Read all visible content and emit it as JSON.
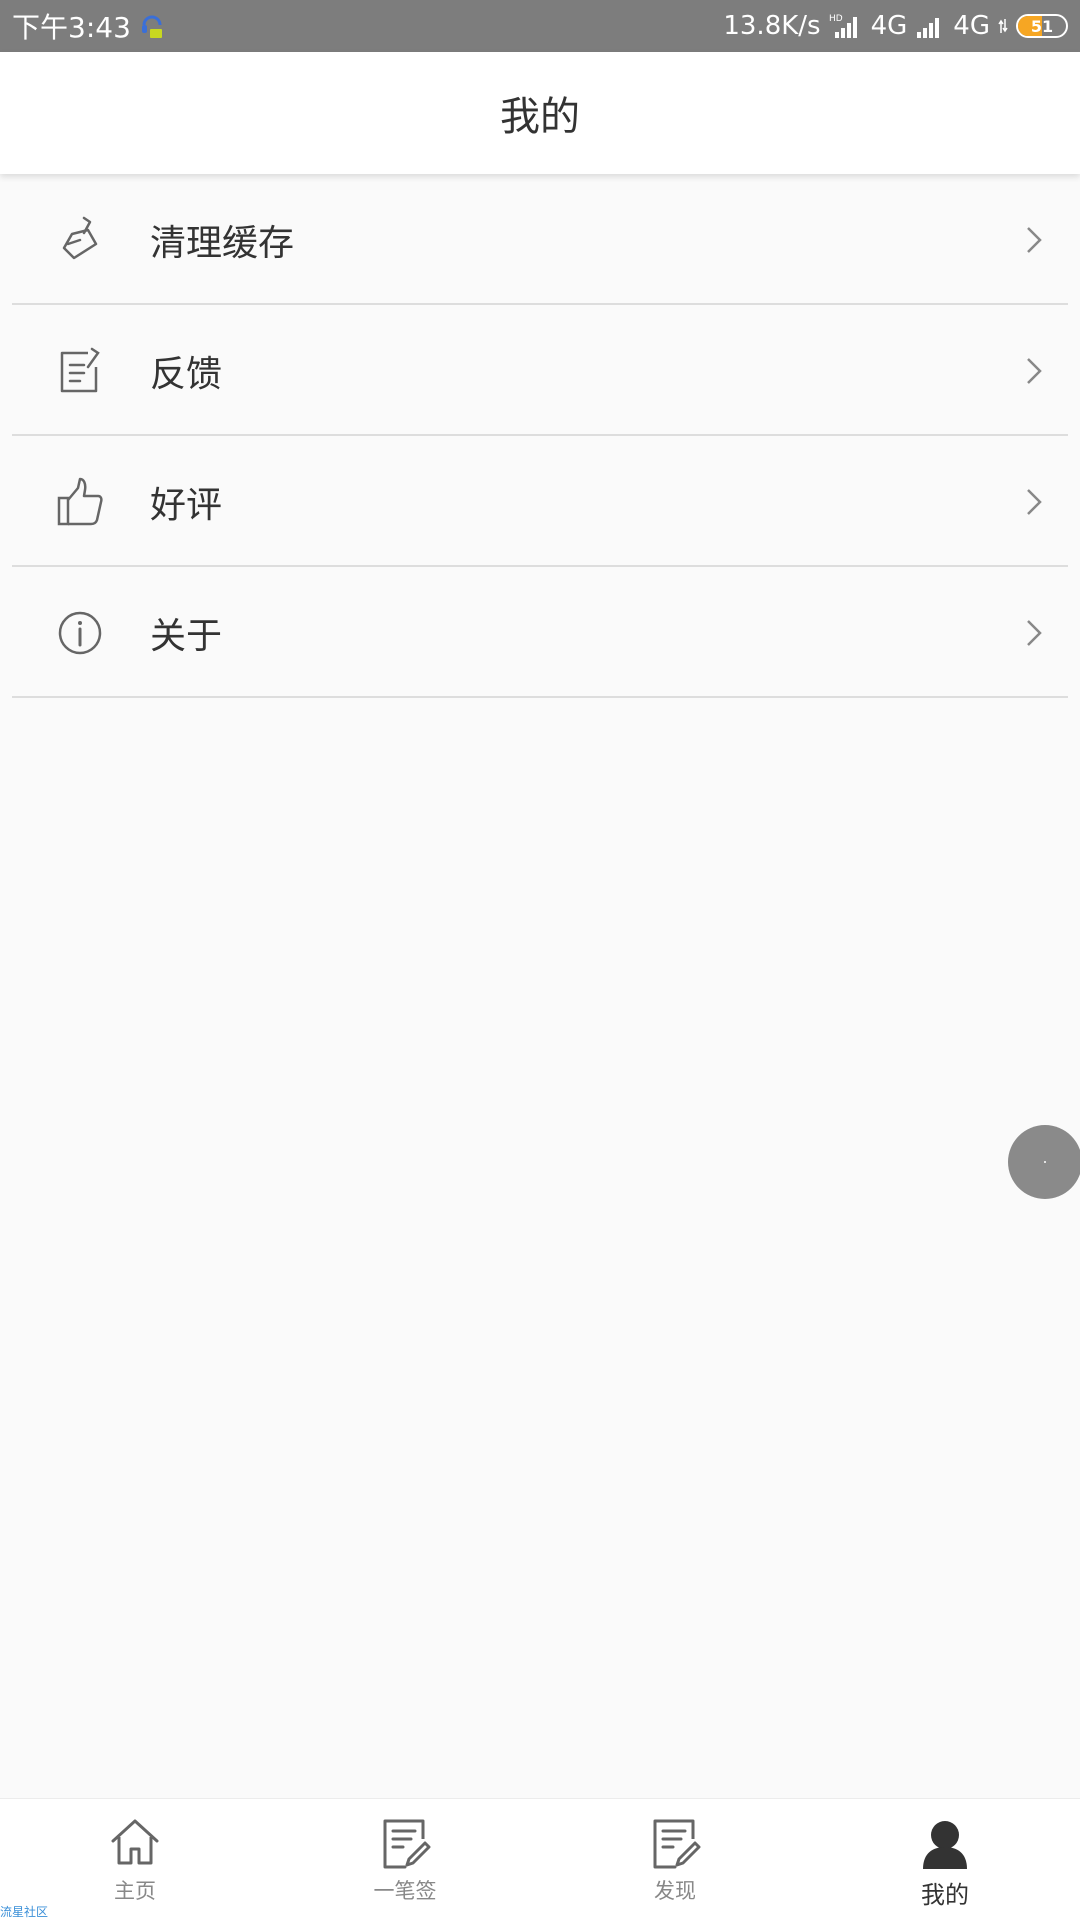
{
  "status_bar": {
    "time": "下午3:43",
    "speed": "13.8K/s",
    "hd": "HD",
    "network1": "4G",
    "network2": "4G",
    "battery": "51"
  },
  "header": {
    "title": "我的"
  },
  "menu": [
    {
      "label": "清理缓存",
      "icon": "broom-icon"
    },
    {
      "label": "反馈",
      "icon": "edit-note-icon"
    },
    {
      "label": "好评",
      "icon": "thumbs-up-icon"
    },
    {
      "label": "关于",
      "icon": "info-icon"
    }
  ],
  "bottom_nav": [
    {
      "label": "主页",
      "icon": "home-icon"
    },
    {
      "label": "一笔签",
      "icon": "sign-note-icon"
    },
    {
      "label": "发现",
      "icon": "discover-note-icon"
    },
    {
      "label": "我的",
      "icon": "user-icon",
      "active": true
    }
  ],
  "watermark": "流星社区",
  "colors": {
    "status_bar": "#7d7d7d",
    "background": "#fafafa",
    "text": "#333333",
    "inactive_nav": "#888888",
    "battery": "#f6a623"
  }
}
